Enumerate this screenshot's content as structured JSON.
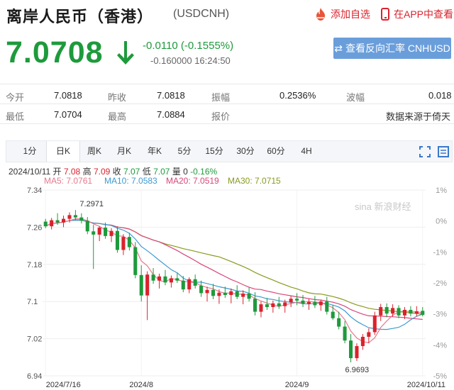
{
  "header": {
    "title": "离岸人民币（香港）",
    "code": "(USDCNH)",
    "add_watchlist": "添加自选",
    "view_in_app": "在APP中查看"
  },
  "quote": {
    "price": "7.0708",
    "change": "-0.0110 (-0.1555%)",
    "pip_change": "-0.160000",
    "time": "16:24:50",
    "swap_button": "查看反向汇率 CNHUSD",
    "down_color": "#1e9a3c"
  },
  "stats": {
    "open_label": "今开",
    "open": "7.0818",
    "prev_close_label": "昨收",
    "prev_close": "7.0818",
    "amplitude_label": "振幅",
    "amplitude": "0.2536%",
    "wave_label": "波幅",
    "wave": "0.018",
    "low_label": "最低",
    "low": "7.0704",
    "high_label": "最高",
    "high": "7.0884",
    "quote_label": "报价",
    "quote": "",
    "source": "数据来源于倚天"
  },
  "tabs": [
    "1分",
    "日K",
    "周K",
    "月K",
    "年K",
    "5分",
    "15分",
    "30分",
    "60分",
    "4H"
  ],
  "active_tab": 1,
  "bar_info": {
    "date": "2024/10/11",
    "open_label": "开",
    "open": "7.08",
    "high_label": "高",
    "high": "7.09",
    "close_label": "收",
    "close": "7.07",
    "low_label": "低",
    "low": "7.07",
    "volume_label": "量",
    "volume": "0",
    "change": "-0.16%"
  },
  "ma": [
    {
      "label": "MA5: 7.0761",
      "color": "#e8788c"
    },
    {
      "label": "MA10: 7.0583",
      "color": "#3d9ad1"
    },
    {
      "label": "MA20: 7.0519",
      "color": "#d9457a"
    },
    {
      "label": "MA30: 7.0715",
      "color": "#8a9a1f"
    }
  ],
  "chart_data": {
    "type": "candlestick",
    "y_ticks": [
      "7.34",
      "7.26",
      "7.18",
      "7.1",
      "7.02",
      "6.94"
    ],
    "y_tick_values": [
      7.34,
      7.26,
      7.18,
      7.1,
      7.02,
      6.94
    ],
    "ylim": [
      6.94,
      7.34
    ],
    "pct_ticks": [
      "1%",
      "0%",
      "-1%",
      "-2%",
      "-3%",
      "-4%",
      "-5%"
    ],
    "x_ticks": [
      "2024/7/16",
      "2024/8",
      "2024/9",
      "2024/10/11"
    ],
    "annotations": {
      "high": "7.2971",
      "low": "6.9693"
    },
    "watermark": "sina 新浪财经",
    "up_color": "#d9232d",
    "down_color": "#1e9a3c",
    "candles": [
      [
        7.272,
        7.278,
        7.258,
        7.262
      ],
      [
        7.262,
        7.28,
        7.255,
        7.275
      ],
      [
        7.275,
        7.29,
        7.265,
        7.27
      ],
      [
        7.27,
        7.285,
        7.26,
        7.278
      ],
      [
        7.278,
        7.292,
        7.27,
        7.286
      ],
      [
        7.286,
        7.297,
        7.275,
        7.281
      ],
      [
        7.281,
        7.29,
        7.268,
        7.274
      ],
      [
        7.274,
        7.282,
        7.245,
        7.251
      ],
      [
        7.251,
        7.265,
        7.17,
        7.244
      ],
      [
        7.244,
        7.262,
        7.23,
        7.259
      ],
      [
        7.259,
        7.27,
        7.235,
        7.241
      ],
      [
        7.241,
        7.258,
        7.228,
        7.252
      ],
      [
        7.252,
        7.262,
        7.205,
        7.211
      ],
      [
        7.211,
        7.245,
        7.2,
        7.239
      ],
      [
        7.239,
        7.248,
        7.21,
        7.217
      ],
      [
        7.217,
        7.228,
        7.15,
        7.157
      ],
      [
        7.157,
        7.178,
        7.1,
        7.113
      ],
      [
        7.113,
        7.165,
        7.06,
        7.158
      ],
      [
        7.158,
        7.172,
        7.138,
        7.145
      ],
      [
        7.145,
        7.16,
        7.128,
        7.154
      ],
      [
        7.154,
        7.168,
        7.135,
        7.141
      ],
      [
        7.141,
        7.156,
        7.13,
        7.15
      ],
      [
        7.15,
        7.162,
        7.14,
        7.145
      ],
      [
        7.145,
        7.155,
        7.12,
        7.126
      ],
      [
        7.126,
        7.152,
        7.118,
        7.148
      ],
      [
        7.148,
        7.158,
        7.128,
        7.134
      ],
      [
        7.134,
        7.145,
        7.11,
        7.118
      ],
      [
        7.118,
        7.132,
        7.1,
        7.125
      ],
      [
        7.125,
        7.138,
        7.105,
        7.112
      ],
      [
        7.112,
        7.126,
        7.095,
        7.119
      ],
      [
        7.119,
        7.132,
        7.108,
        7.114
      ],
      [
        7.114,
        7.128,
        7.096,
        7.122
      ],
      [
        7.122,
        7.135,
        7.105,
        7.11
      ],
      [
        7.11,
        7.124,
        7.094,
        7.117
      ],
      [
        7.117,
        7.13,
        7.1,
        7.106
      ],
      [
        7.106,
        7.12,
        7.07,
        7.078
      ],
      [
        7.078,
        7.1,
        7.066,
        7.094
      ],
      [
        7.094,
        7.108,
        7.082,
        7.088
      ],
      [
        7.088,
        7.102,
        7.076,
        7.096
      ],
      [
        7.096,
        7.11,
        7.084,
        7.09
      ],
      [
        7.09,
        7.104,
        7.076,
        7.098
      ],
      [
        7.098,
        7.112,
        7.088,
        7.106
      ],
      [
        7.106,
        7.118,
        7.092,
        7.102
      ],
      [
        7.102,
        7.114,
        7.088,
        7.095
      ],
      [
        7.095,
        7.106,
        7.082,
        7.099
      ],
      [
        7.099,
        7.112,
        7.086,
        7.092
      ],
      [
        7.092,
        7.104,
        7.08,
        7.1
      ],
      [
        7.1,
        7.11,
        7.072,
        7.078
      ],
      [
        7.078,
        7.092,
        7.06,
        7.064
      ],
      [
        7.064,
        7.078,
        7.04,
        7.046
      ],
      [
        7.046,
        7.058,
        7.01,
        7.016
      ],
      [
        7.016,
        7.03,
        6.969,
        6.978
      ],
      [
        6.978,
        7.01,
        6.972,
        7.004
      ],
      [
        7.004,
        7.03,
        6.996,
        7.024
      ],
      [
        7.024,
        7.042,
        7.01,
        7.034
      ],
      [
        7.034,
        7.078,
        7.028,
        7.07
      ],
      [
        7.07,
        7.095,
        7.058,
        7.088
      ],
      [
        7.088,
        7.096,
        7.066,
        7.074
      ],
      [
        7.074,
        7.094,
        7.068,
        7.086
      ],
      [
        7.086,
        7.092,
        7.064,
        7.07
      ],
      [
        7.07,
        7.088,
        7.062,
        7.082
      ],
      [
        7.082,
        7.09,
        7.068,
        7.074
      ],
      [
        7.074,
        7.09,
        7.068,
        7.079
      ],
      [
        7.08,
        7.088,
        7.068,
        7.071
      ]
    ]
  }
}
